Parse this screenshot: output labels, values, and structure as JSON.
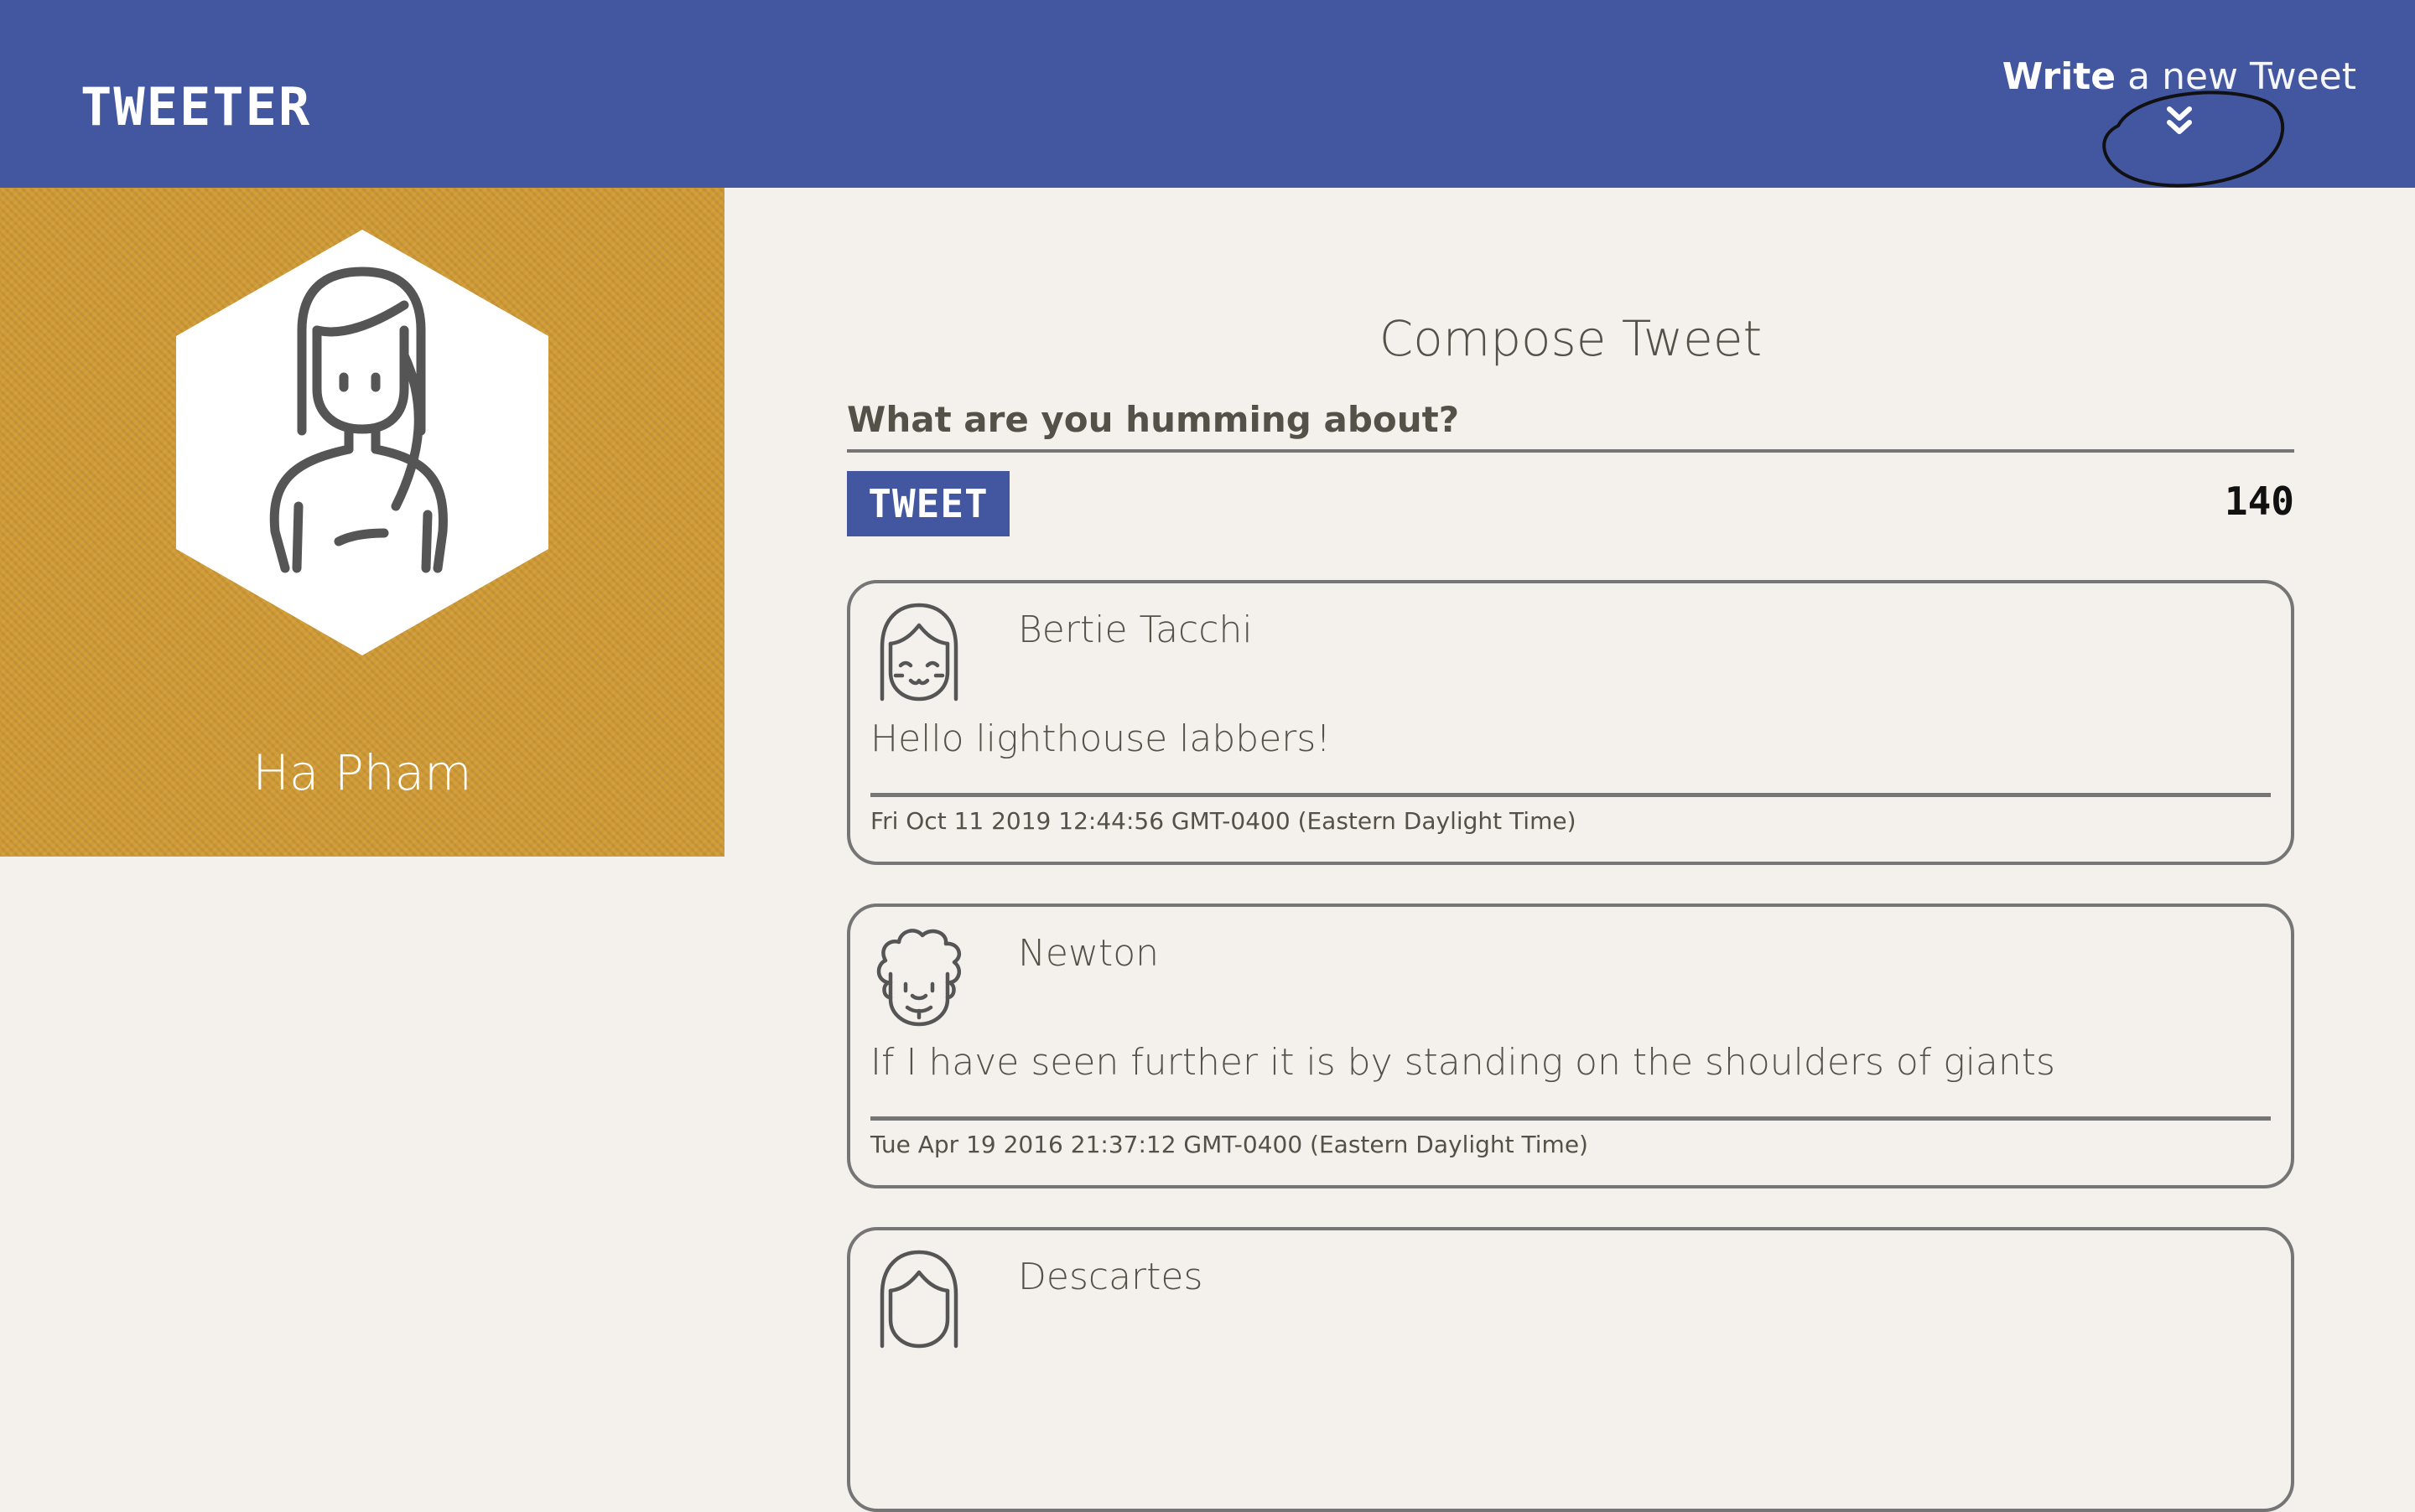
{
  "nav": {
    "logo": "TWEETER",
    "write_bold": "Write",
    "write_rest": " a new Tweet",
    "toggle_icon": "double-chevron-down-icon"
  },
  "profile": {
    "name": "Ha Pham",
    "avatar_icon": "user-avatar-icon",
    "background_color": "#d09a35"
  },
  "compose": {
    "title": "Compose Tweet",
    "placeholder": "What are you humming about?",
    "button_label": "TWEET",
    "counter": "140"
  },
  "tweets": [
    {
      "author": "Bertie Tacchi",
      "content": "Hello lighthouse labbers!",
      "timestamp": "Fri Oct 11 2019 12:44:56 GMT-0400 (Eastern Daylight Time)",
      "avatar_icon": "girl-avatar-icon"
    },
    {
      "author": "Newton",
      "content": "If I have seen further it is by standing on the shoulders of giants",
      "timestamp": "Tue Apr 19 2016 21:37:12 GMT-0400 (Eastern Daylight Time)",
      "avatar_icon": "curly-hair-avatar-icon"
    },
    {
      "author": "Descartes",
      "content": "",
      "timestamp": "",
      "avatar_icon": "girl-avatar-icon"
    }
  ],
  "colors": {
    "nav": "#4356a0",
    "background": "#f4f1ec",
    "text": "#545149",
    "border": "#757575"
  }
}
